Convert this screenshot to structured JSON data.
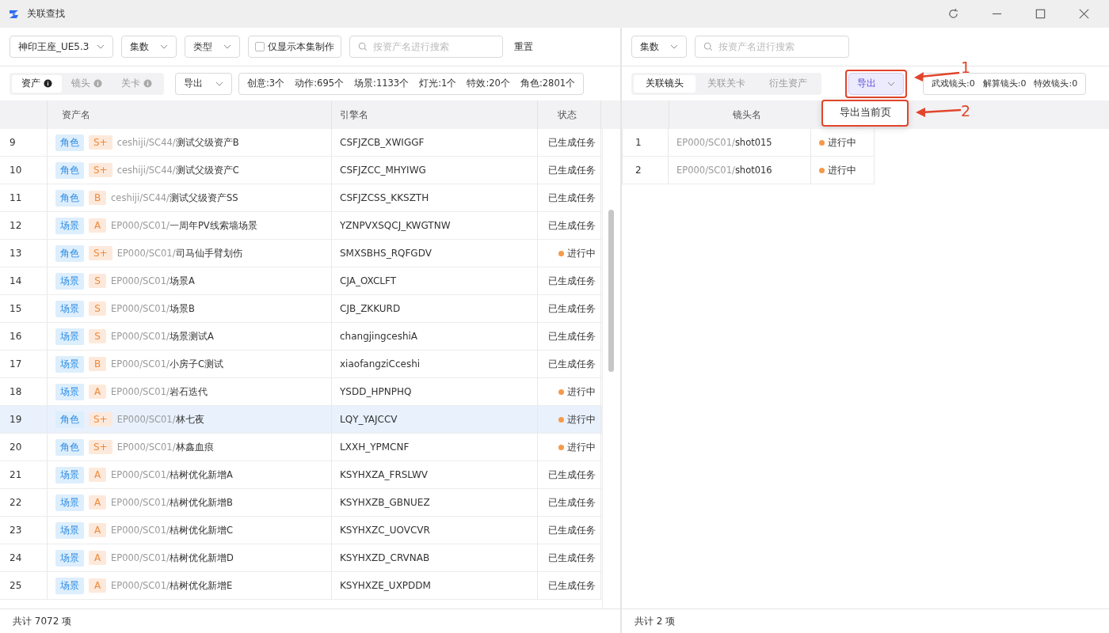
{
  "window": {
    "title": "关联查找"
  },
  "left": {
    "filters": {
      "project": "神印王座_UE5.3",
      "episode": "集数",
      "type": "类型",
      "only_current": {
        "label": "仅显示本集制作",
        "checked": false
      },
      "search": {
        "placeholder": "按资产名进行搜索"
      },
      "reset": "重置"
    },
    "tabs": [
      {
        "label": "资产",
        "selected": true
      },
      {
        "label": "镜头",
        "selected": false
      },
      {
        "label": "关卡",
        "selected": false
      }
    ],
    "export": "导出",
    "stats": [
      "创意:3个",
      "动作:695个",
      "场景:1133个",
      "灯光:1个",
      "特效:20个",
      "角色:2801个"
    ],
    "table": {
      "columns": [
        "资产名",
        "引擎名",
        "状态"
      ],
      "rows": [
        {
          "no": "9",
          "category": "角色",
          "grade": "S+",
          "path": "ceshiji/SC44/",
          "name": "测试父级资产B",
          "engine": "CSFJZCB_XWIGGF",
          "status": {
            "kind": "done",
            "text": "已生成任务"
          },
          "selected": false
        },
        {
          "no": "10",
          "category": "角色",
          "grade": "S+",
          "path": "ceshiji/SC44/",
          "name": "测试父级资产C",
          "engine": "CSFJZCC_MHYIWG",
          "status": {
            "kind": "done",
            "text": "已生成任务"
          },
          "selected": false
        },
        {
          "no": "11",
          "category": "角色",
          "grade": "B",
          "path": "ceshiji/SC44/",
          "name": "测试父级资产SS",
          "engine": "CSFJZCSS_KKSZTH",
          "status": {
            "kind": "done",
            "text": "已生成任务"
          },
          "selected": false
        },
        {
          "no": "12",
          "category": "场景",
          "grade": "A",
          "path": "EP000/SC01/",
          "name": "一周年PV线索墙场景",
          "engine": "YZNPVXSQCJ_KWGTNW",
          "status": {
            "kind": "done",
            "text": "已生成任务"
          },
          "selected": false
        },
        {
          "no": "13",
          "category": "角色",
          "grade": "S+",
          "path": "EP000/SC01/",
          "name": "司马仙手臂划伤",
          "engine": "SMXSBHS_RQFGDV",
          "status": {
            "kind": "progress",
            "text": "进行中"
          },
          "selected": false
        },
        {
          "no": "14",
          "category": "场景",
          "grade": "S",
          "path": "EP000/SC01/",
          "name": "场景A",
          "engine": "CJA_OXCLFT",
          "status": {
            "kind": "done",
            "text": "已生成任务"
          },
          "selected": false
        },
        {
          "no": "15",
          "category": "场景",
          "grade": "S",
          "path": "EP000/SC01/",
          "name": "场景B",
          "engine": "CJB_ZKKURD",
          "status": {
            "kind": "done",
            "text": "已生成任务"
          },
          "selected": false
        },
        {
          "no": "16",
          "category": "场景",
          "grade": "S",
          "path": "EP000/SC01/",
          "name": "场景测试A",
          "engine": "changjingceshiA",
          "status": {
            "kind": "done",
            "text": "已生成任务"
          },
          "selected": false
        },
        {
          "no": "17",
          "category": "场景",
          "grade": "B",
          "path": "EP000/SC01/",
          "name": "小房子C测试",
          "engine": "xiaofangziCceshi",
          "status": {
            "kind": "done",
            "text": "已生成任务"
          },
          "selected": false
        },
        {
          "no": "18",
          "category": "场景",
          "grade": "A",
          "path": "EP000/SC01/",
          "name": "岩石迭代",
          "engine": "YSDD_HPNPHQ",
          "status": {
            "kind": "progress",
            "text": "进行中"
          },
          "selected": false
        },
        {
          "no": "19",
          "category": "角色",
          "grade": "S+",
          "path": "EP000/SC01/",
          "name": "林七夜",
          "engine": "LQY_YAJCCV",
          "status": {
            "kind": "progress",
            "text": "进行中"
          },
          "selected": true
        },
        {
          "no": "20",
          "category": "角色",
          "grade": "S+",
          "path": "EP000/SC01/",
          "name": "林鑫血痕",
          "engine": "LXXH_YPMCNF",
          "status": {
            "kind": "progress",
            "text": "进行中"
          },
          "selected": false
        },
        {
          "no": "21",
          "category": "场景",
          "grade": "A",
          "path": "EP000/SC01/",
          "name": "桔树优化新增A",
          "engine": "KSYHXZA_FRSLWV",
          "status": {
            "kind": "done",
            "text": "已生成任务"
          },
          "selected": false
        },
        {
          "no": "22",
          "category": "场景",
          "grade": "A",
          "path": "EP000/SC01/",
          "name": "桔树优化新增B",
          "engine": "KSYHXZB_GBNUEZ",
          "status": {
            "kind": "done",
            "text": "已生成任务"
          },
          "selected": false
        },
        {
          "no": "23",
          "category": "场景",
          "grade": "A",
          "path": "EP000/SC01/",
          "name": "桔树优化新增C",
          "engine": "KSYHXZC_UOVCVR",
          "status": {
            "kind": "done",
            "text": "已生成任务"
          },
          "selected": false
        },
        {
          "no": "24",
          "category": "场景",
          "grade": "A",
          "path": "EP000/SC01/",
          "name": "桔树优化新增D",
          "engine": "KSYHXZD_CRVNAB",
          "status": {
            "kind": "done",
            "text": "已生成任务"
          },
          "selected": false
        },
        {
          "no": "25",
          "category": "场景",
          "grade": "A",
          "path": "EP000/SC01/",
          "name": "桔树优化新增E",
          "engine": "KSYHXZE_UXPDDM",
          "status": {
            "kind": "done",
            "text": "已生成任务"
          },
          "selected": false
        }
      ]
    },
    "footer": "共计 7072 项"
  },
  "right": {
    "filters": {
      "episode": "集数",
      "search": {
        "placeholder": "按资产名进行搜索"
      }
    },
    "tabs": [
      {
        "label": "关联镜头",
        "selected": true
      },
      {
        "label": "关联关卡",
        "selected": false
      },
      {
        "label": "衍生资产",
        "selected": false
      }
    ],
    "export": {
      "label": "导出",
      "expanded": true,
      "menu": [
        "导出当前页"
      ]
    },
    "stats": [
      "武戏镜头:0",
      "解算镜头:0",
      "特效镜头:0"
    ],
    "table": {
      "columns": [
        "镜头名"
      ],
      "rows": [
        {
          "no": "1",
          "path": "EP000/SC01/",
          "name": "shot015",
          "status": {
            "kind": "progress",
            "text": "进行中"
          }
        },
        {
          "no": "2",
          "path": "EP000/SC01/",
          "name": "shot016",
          "status": {
            "kind": "progress",
            "text": "进行中"
          }
        }
      ]
    },
    "footer": "共计 2 项"
  },
  "annotations": [
    "1",
    "2"
  ]
}
